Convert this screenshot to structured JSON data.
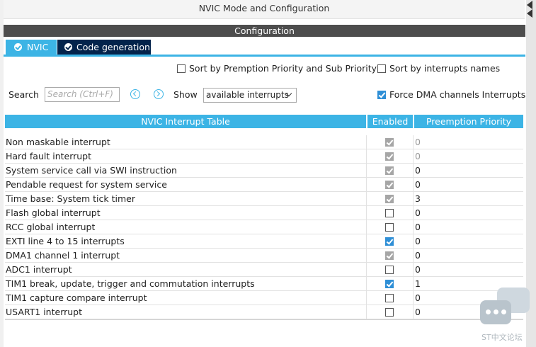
{
  "window": {
    "title": "NVIC Mode and Configuration"
  },
  "config": {
    "title": "Configuration"
  },
  "tabs": [
    {
      "label": "NVIC",
      "active": true
    },
    {
      "label": "Code generation",
      "active": false
    }
  ],
  "options": {
    "sort_premption_label": "Sort by Premption Priority and Sub Priority",
    "sort_premption_checked": false,
    "sort_names_label": "Sort by interrupts names",
    "sort_names_checked": false,
    "force_dma_label": "Force DMA channels Interrupts",
    "force_dma_checked": true
  },
  "search": {
    "label": "Search",
    "placeholder": "Search (Ctrl+F)",
    "show_label": "Show",
    "show_value": "available interrupts"
  },
  "table": {
    "columns": {
      "name": "NVIC Interrupt Table",
      "enabled": "Enabled",
      "priority": "Preemption Priority"
    },
    "rows": [
      {
        "name": "Non maskable interrupt",
        "enabled": true,
        "locked": true,
        "priority": "0"
      },
      {
        "name": "Hard fault interrupt",
        "enabled": true,
        "locked": true,
        "priority": "0"
      },
      {
        "name": "System service call via SWI instruction",
        "enabled": true,
        "locked": true,
        "priority": "0"
      },
      {
        "name": "Pendable request for system service",
        "enabled": true,
        "locked": true,
        "priority": "0"
      },
      {
        "name": "Time base: System tick timer",
        "enabled": true,
        "locked": true,
        "priority": "3"
      },
      {
        "name": "Flash global interrupt",
        "enabled": false,
        "locked": false,
        "priority": "0"
      },
      {
        "name": "RCC global interrupt",
        "enabled": false,
        "locked": false,
        "priority": "0"
      },
      {
        "name": "EXTI line 4 to 15 interrupts",
        "enabled": true,
        "locked": false,
        "priority": "0"
      },
      {
        "name": "DMA1 channel 1 interrupt",
        "enabled": true,
        "locked": true,
        "priority": "0"
      },
      {
        "name": "ADC1 interrupt",
        "enabled": false,
        "locked": false,
        "priority": "0"
      },
      {
        "name": "TIM1 break, update, trigger and commutation interrupts",
        "enabled": true,
        "locked": false,
        "priority": "1"
      },
      {
        "name": "TIM1 capture compare interrupt",
        "enabled": false,
        "locked": false,
        "priority": "0"
      },
      {
        "name": "USART1 interrupt",
        "enabled": false,
        "locked": false,
        "priority": "0"
      }
    ]
  },
  "watermark": {
    "text": "ST中文论坛"
  },
  "colors": {
    "accent": "#3cb4e5",
    "dark_tab": "#03234b",
    "header_bar": "#4d4d4d",
    "checkbox_on": "#2f8fd6"
  }
}
